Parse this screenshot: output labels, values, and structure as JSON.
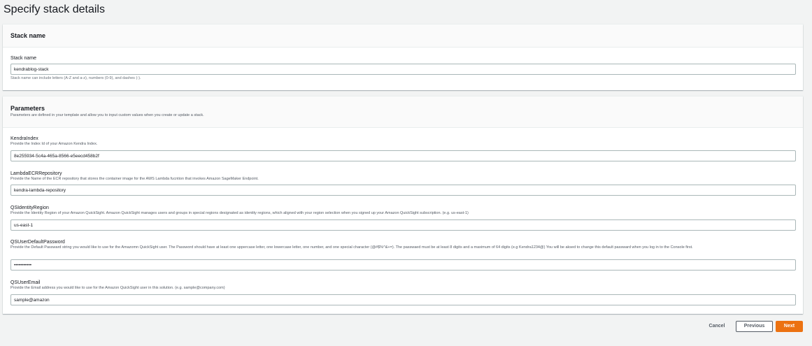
{
  "page": {
    "title": "Specify stack details"
  },
  "stack_section": {
    "heading": "Stack name",
    "field_label": "Stack name",
    "value": "kendrablog-stack",
    "constraint": "Stack name can include letters (A-Z and a-z), numbers (0-9), and dashes (-)."
  },
  "parameters": {
    "heading": "Parameters",
    "description": "Parameters are defined in your template and allow you to input custom values when you create or update a stack.",
    "fields": [
      {
        "label": "KendraIndex",
        "description": "Provide the Index Id of your Amazon Kendra Index.",
        "value": "8e255934-5c4a-465a-8566-e5eecd458b2f"
      },
      {
        "label": "LambdaECRRepository",
        "description": "Provide the Name of the ECR repository that stores the container image for the AWS Lambda fucntion that invokes Amazon SageMaker Endpoint.",
        "value": "kendra-lambda-repository"
      },
      {
        "label": "QSIdentityRegion",
        "description": "Provide the Identity Region of your Amazon QuickSight. Amazon QuickSight manages users and groups in special regions designated as identity regions, which aligned with your region selection when you signed up your Amazon QuickSight subscription. (e.g. us-east-1)",
        "value": "us-east-1"
      },
      {
        "label": "QSUserDefaultPassword",
        "description": "Provide the Default Passward string you would like to use for the Amazomn QuickSight user. The Password should have at least one uppercase letter, one lowercase letter, one number, and one special character (@#$%^&+=). The passwaed must be at least 8 digits and a maximum of 64 digits (e.g Kendra1234@) You will be aksed to change this default passward when you log in to the Console first.",
        "value": "•••••••••••"
      },
      {
        "label": "QSUserEmail",
        "description": "Provide the Email address you would like to use for the Amazon QuickSight user in this solution. (e.g. sample@company.com)",
        "value": "sample@amazon"
      }
    ]
  },
  "footer": {
    "cancel_label": "Cancel",
    "previous_label": "Previous",
    "next_label": "Next"
  },
  "colors": {
    "primary": "#ec7211",
    "background": "#f2f3f3",
    "border": "#aab7b8"
  }
}
